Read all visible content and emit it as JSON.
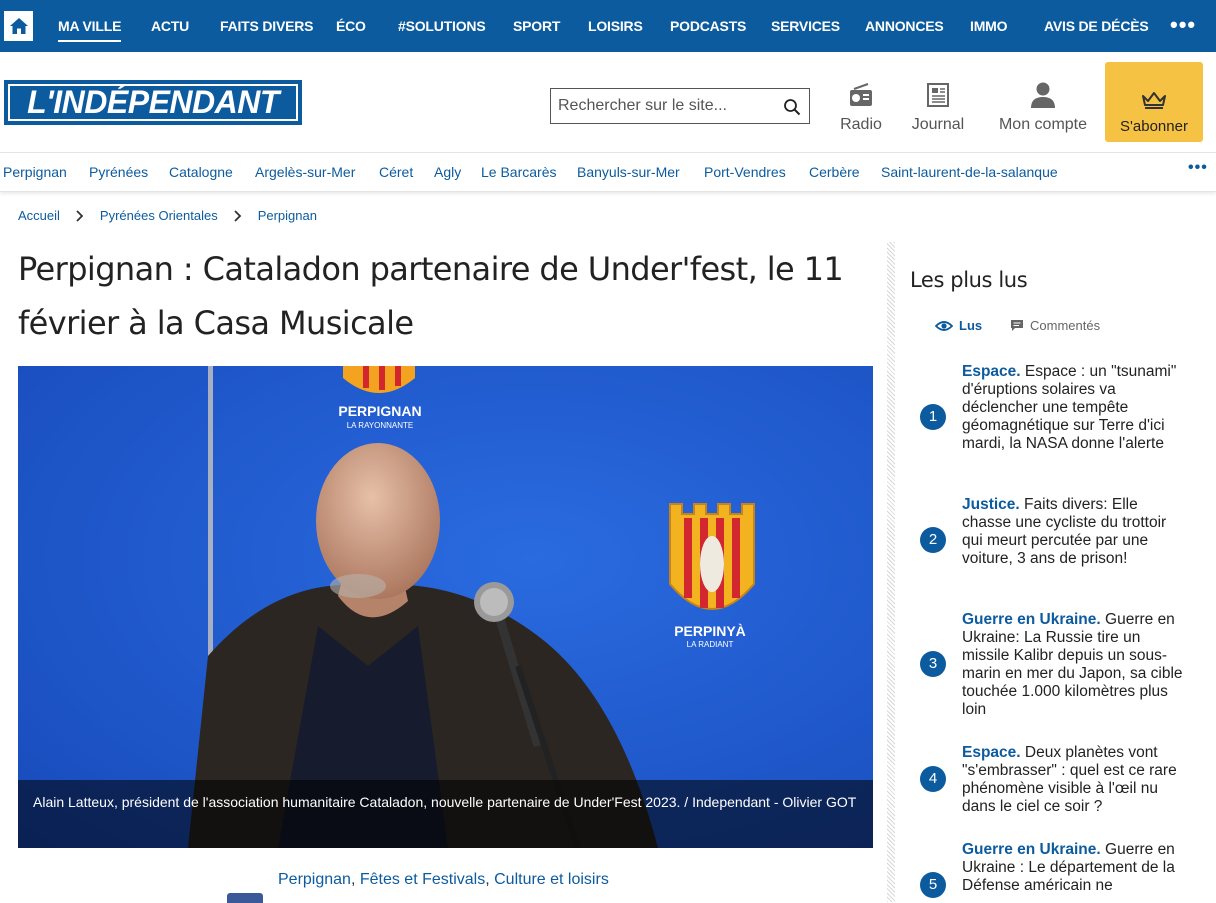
{
  "topnav": {
    "items": [
      "MA VILLE",
      "ACTU",
      "FAITS DIVERS",
      "ÉCO",
      "#SOLUTIONS",
      "SPORT",
      "LOISIRS",
      "PODCASTS",
      "SERVICES",
      "ANNONCES",
      "IMMO",
      "AVIS DE DÉCÈS"
    ],
    "active": "MA VILLE",
    "more": "•••"
  },
  "header": {
    "logo_text": "L'INDÉPENDANT",
    "search_placeholder": "Rechercher sur le site...",
    "radio_label": "Radio",
    "journal_label": "Journal",
    "account_label": "Mon compte",
    "subscribe_label": "S'abonner"
  },
  "subnav": {
    "items": [
      "Perpignan",
      "Pyrénées",
      "Catalogne",
      "Argelès-sur-Mer",
      "Céret",
      "Agly",
      "Le Barcarès",
      "Banyuls-sur-Mer",
      "Port-Vendres",
      "Cerbère",
      "Saint-laurent-de-la-salanque"
    ],
    "more": "•••"
  },
  "breadcrumb": [
    "Accueil",
    "Pyrénées Orientales",
    "Perpignan"
  ],
  "article": {
    "title": "Perpignan : Cataladon partenaire de Under'fest, le 11 février à la Casa Musicale",
    "caption": "Alain Latteux, président de l'association humanitaire Cataladon, nouvelle partenaire de Under'Fest 2023.  / Independant - Olivier GOT",
    "photo_text_top": "PERPIGNAN",
    "photo_text_top_sub": "LA RAYONNANTE",
    "photo_text_right": "PERPINYÀ",
    "photo_text_right_sub": "LA RADIANT",
    "tags": [
      "Perpignan",
      "Fêtes et Festivals",
      "Culture et loisirs"
    ]
  },
  "sidebar": {
    "title": "Les plus lus",
    "tab_read": "Lus",
    "tab_comments": "Commentés",
    "items": [
      {
        "num": "1",
        "cat": "Espace.",
        "text": "Espace : un \"tsunami\" d'éruptions solaires va déclencher une tempête géomagnétique sur Terre d'ici mardi, la NASA donne l'alerte"
      },
      {
        "num": "2",
        "cat": "Justice.",
        "text": "Faits divers: Elle chasse une cycliste du trottoir qui meurt percutée par une voiture, 3 ans de prison!"
      },
      {
        "num": "3",
        "cat": "Guerre en Ukraine.",
        "text": "Guerre en Ukraine: La Russie tire un missile Kalibr depuis un sous-marin en mer du Japon, sa cible touchée 1.000 kilomètres plus loin"
      },
      {
        "num": "4",
        "cat": "Espace.",
        "text": "Deux planètes vont \"s'embrasser\" : quel est ce rare phénomène visible à l'œil nu dans le ciel ce soir ?"
      },
      {
        "num": "5",
        "cat": "Guerre en Ukraine.",
        "text": "Guerre en Ukraine : Le département de la Défense américain ne"
      }
    ]
  },
  "colors": {
    "brand": "#0c5b9e",
    "subscribe": "#f6c244"
  }
}
